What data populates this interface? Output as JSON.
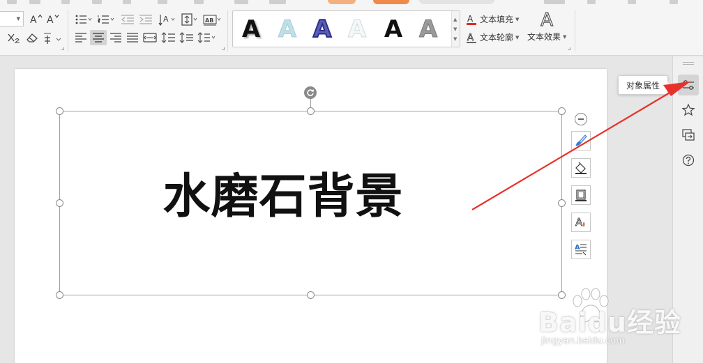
{
  "ribbon": {
    "text_styles": [
      "A",
      "A",
      "A",
      "A",
      "A",
      "A"
    ],
    "text_fill_label": "文本填充",
    "text_outline_label": "文本轮廓",
    "text_effect_label": "文本效果",
    "text_effect_glyph": "A"
  },
  "canvas": {
    "headline": "水磨石背景"
  },
  "sidebar": {
    "tooltip": "对象属性"
  },
  "watermark": {
    "brand": "Baidu经验",
    "url": "jingyan.baidu.com"
  },
  "colors": {
    "arrow": "#e8312a",
    "accent": "#f08a4b"
  }
}
